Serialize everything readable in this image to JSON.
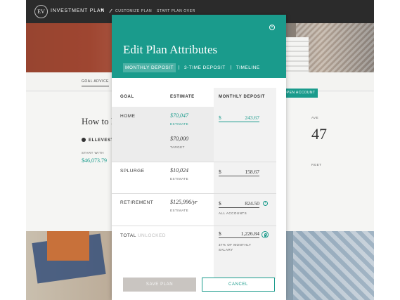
{
  "app": {
    "logo_text": "EV",
    "title": "INVESTMENT PLAN",
    "links": {
      "customize": "CUSTOMIZE PLAN",
      "start": "START PLAN OVER"
    }
  },
  "background": {
    "tab_goal_advice": "GOAL ADVICE",
    "open_account": "OPEN ACCOUNT",
    "heading": "How to D",
    "ellevest": "ELLEVEST",
    "start_with_label": "START WITH",
    "start_with_value": "$46,073.79",
    "right_label": "AVE",
    "right_big": "47",
    "right_target": "RGET"
  },
  "modal": {
    "title": "Edit Plan Attributes",
    "tabs": [
      {
        "label": "MONTHLY DEPOSIT",
        "active": true
      },
      {
        "label": "3-TIME DEPOSIT",
        "active": false
      },
      {
        "label": "TIMELINE",
        "active": false
      }
    ],
    "columns": {
      "goal": "GOAL",
      "estimate": "ESTIMATE",
      "deposit": "MONTHLY DEPOSIT"
    },
    "rows": [
      {
        "goal": "HOME",
        "estimate": "$70,047",
        "estimate_label": "ESTIMATE",
        "target": "$70,000",
        "target_label": "TARGET",
        "currency": "$",
        "deposit": "243.67"
      },
      {
        "goal": "SPLURGE",
        "estimate": "$10,024",
        "estimate_label": "ESTIMATE",
        "currency": "$",
        "deposit": "158.67"
      },
      {
        "goal": "RETIREMENT",
        "estimate": "$125,996/yr",
        "estimate_label": "ESTIMATE",
        "currency": "$",
        "deposit": "824.50",
        "note": "ALL ACCOUNTS"
      }
    ],
    "total": {
      "label": "TOTAL",
      "sub": "UNLOCKED",
      "currency": "$",
      "value": "1,226.84",
      "note_line1": "37% OF MONTHLY",
      "note_line2": "SALARY"
    },
    "buttons": {
      "save": "SAVE PLAN",
      "cancel": "CANCEL"
    }
  },
  "colors": {
    "accent": "#1a9b8c",
    "nav": "#2b2b2b",
    "disabled": "#c9c5c1"
  }
}
